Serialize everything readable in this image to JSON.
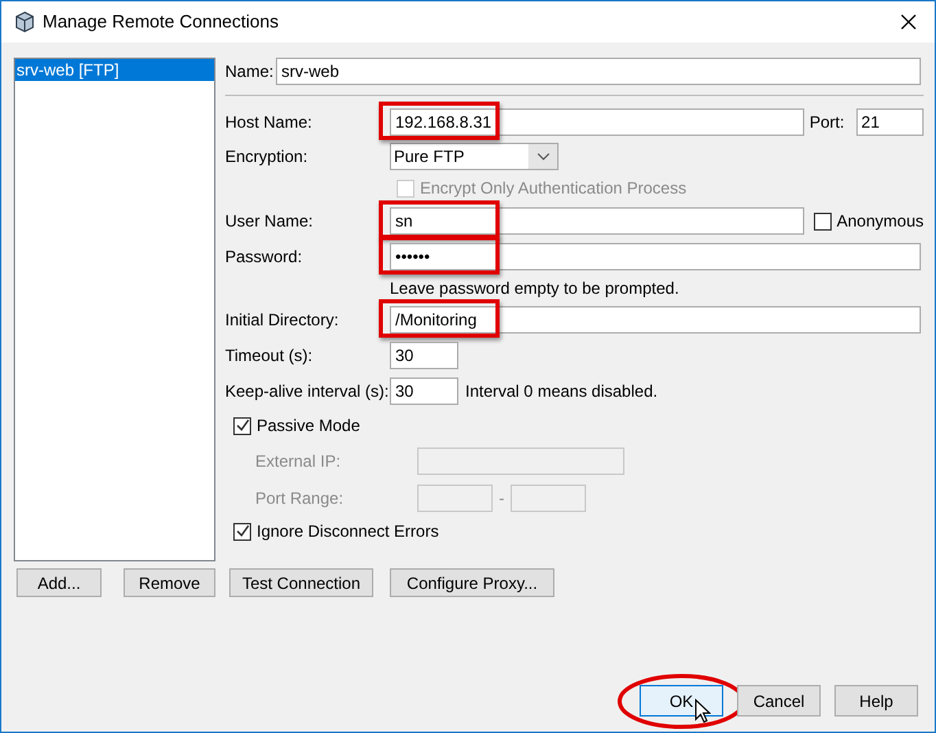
{
  "window": {
    "title": "Manage Remote Connections"
  },
  "connections": [
    {
      "label": "srv-web [FTP]",
      "selected": true
    }
  ],
  "name_field": {
    "label": "Name:",
    "value": "srv-web"
  },
  "rows": [
    {
      "kind": "host",
      "label": "Host Name:",
      "value": "192.168.8.31",
      "highlighted": true,
      "port_label": "Port:",
      "port_value": "21"
    },
    {
      "kind": "combo",
      "label": "Encryption:",
      "value": "Pure FTP"
    },
    {
      "kind": "sub_checkbox",
      "label": "Encrypt Only Authentication Process",
      "checked": false,
      "disabled": true
    },
    {
      "kind": "user",
      "label": "User Name:",
      "value": "sn",
      "highlighted": true,
      "check_label": "Anonymous",
      "checked": false
    },
    {
      "kind": "password",
      "label": "Password:",
      "value": "••••••",
      "highlighted": true
    },
    {
      "kind": "hint",
      "text": "Leave password empty to be prompted."
    },
    {
      "kind": "text",
      "label": "Initial Directory:",
      "value": "/Monitoring",
      "highlighted": true
    },
    {
      "kind": "short",
      "label": "Timeout (s):",
      "value": "30"
    },
    {
      "kind": "short",
      "label": "Keep-alive interval (s):",
      "value": "30",
      "note": "Interval 0 means disabled."
    },
    {
      "kind": "checkbox",
      "label": "Passive Mode",
      "checked": true
    },
    {
      "kind": "sub_text",
      "label": "External IP:",
      "disabled": true
    },
    {
      "kind": "range",
      "label": "Port Range:",
      "separator": "-",
      "disabled": true
    },
    {
      "kind": "checkbox",
      "label": "Ignore Disconnect Errors",
      "checked": true
    }
  ],
  "actions": [
    "Add...",
    "Remove",
    "Test Connection",
    "Configure Proxy..."
  ],
  "footer": [
    {
      "label": "OK",
      "default": true,
      "circled": true
    },
    {
      "label": "Cancel",
      "default": false,
      "circled": false
    },
    {
      "label": "Help",
      "default": false,
      "circled": false
    }
  ]
}
